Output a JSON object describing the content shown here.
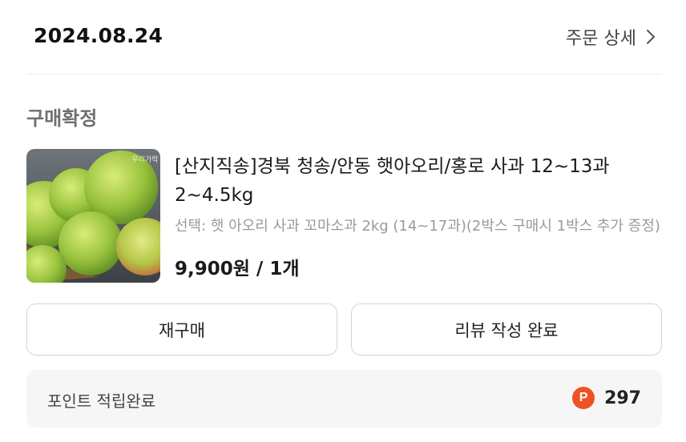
{
  "order": {
    "date": "2024.08.24",
    "detail_link_label": "주문 상세",
    "status": "구매확정"
  },
  "product": {
    "title": "[산지직송]경북 청송/안동 햇아오리/홍로 사과 12~13과 2~4.5kg",
    "option": "선택: 햇 아오리 사과 꼬마소과 2kg (14~17과)(2박스 구매시 1박스 추가 증정)",
    "price": "9,900원 / 1개",
    "thumb_logo_text": "우리가락"
  },
  "actions": {
    "rebuy_label": "재구매",
    "review_label": "리뷰 작성 완료"
  },
  "points": {
    "label": "포인트 적립완료",
    "badge": "P",
    "value": "297",
    "badge_color": "#ef5224"
  },
  "icons": {
    "detail_chevron": "chevron-right-icon",
    "points_badge": "point-p-icon"
  }
}
